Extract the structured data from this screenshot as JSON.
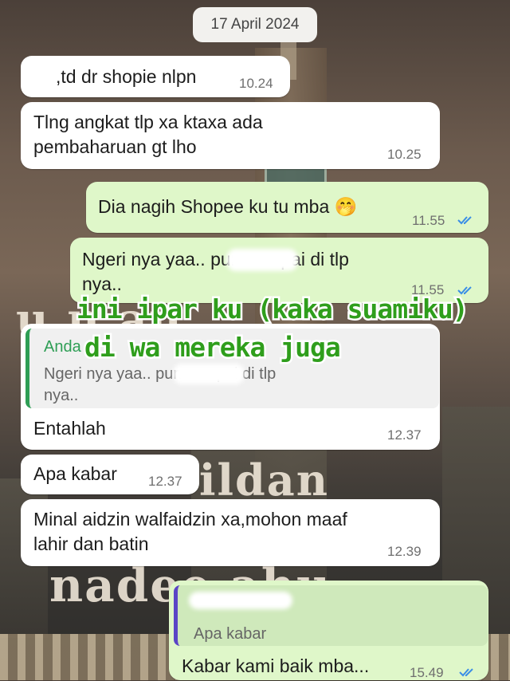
{
  "date_chip": "17 April 2024",
  "messages": [
    {
      "text": ",td dr shopie nlpn",
      "time": "10.24"
    },
    {
      "text": "Tlng angkat tlp xa ktaxa  ada\npembaharuan gt lho",
      "time": "10.25"
    },
    {
      "text": "Dia nagih Shopee ku tu mba 🤭",
      "time": "11.55"
    },
    {
      "text": "Ngeri nya yaa..                  pun sampai di tlp\nnya..",
      "time": "11.55"
    },
    {
      "text": "Entahlah",
      "time": "12.37",
      "quote": {
        "author": "Anda",
        "text": "Ngeri nya yaa..                  pun sampai di tlp\nnya.."
      }
    },
    {
      "text": "Apa kabar",
      "time": "12.37"
    },
    {
      "text": "Minal aidzin walfaidzin xa,mohon maaf\nlahir dan batin",
      "time": "12.39"
    },
    {
      "text": "Kabar kami baik mba...",
      "time": "15.49",
      "quote": {
        "author": "",
        "text": "Apa kabar"
      }
    }
  ],
  "annotation": {
    "line1": "ini ipar ku (kaka suamiku)",
    "line2": "di wa mereka juga"
  },
  "background_text": {
    "top": "u         n      an",
    "middle": "ildan",
    "bottom": "nadee     ahu"
  },
  "colors": {
    "incoming_bubble": "#ffffff",
    "outgoing_bubble": "#dff7c9",
    "read_tick": "#3a8ee6",
    "annotation_green": "#2f9e1c"
  }
}
